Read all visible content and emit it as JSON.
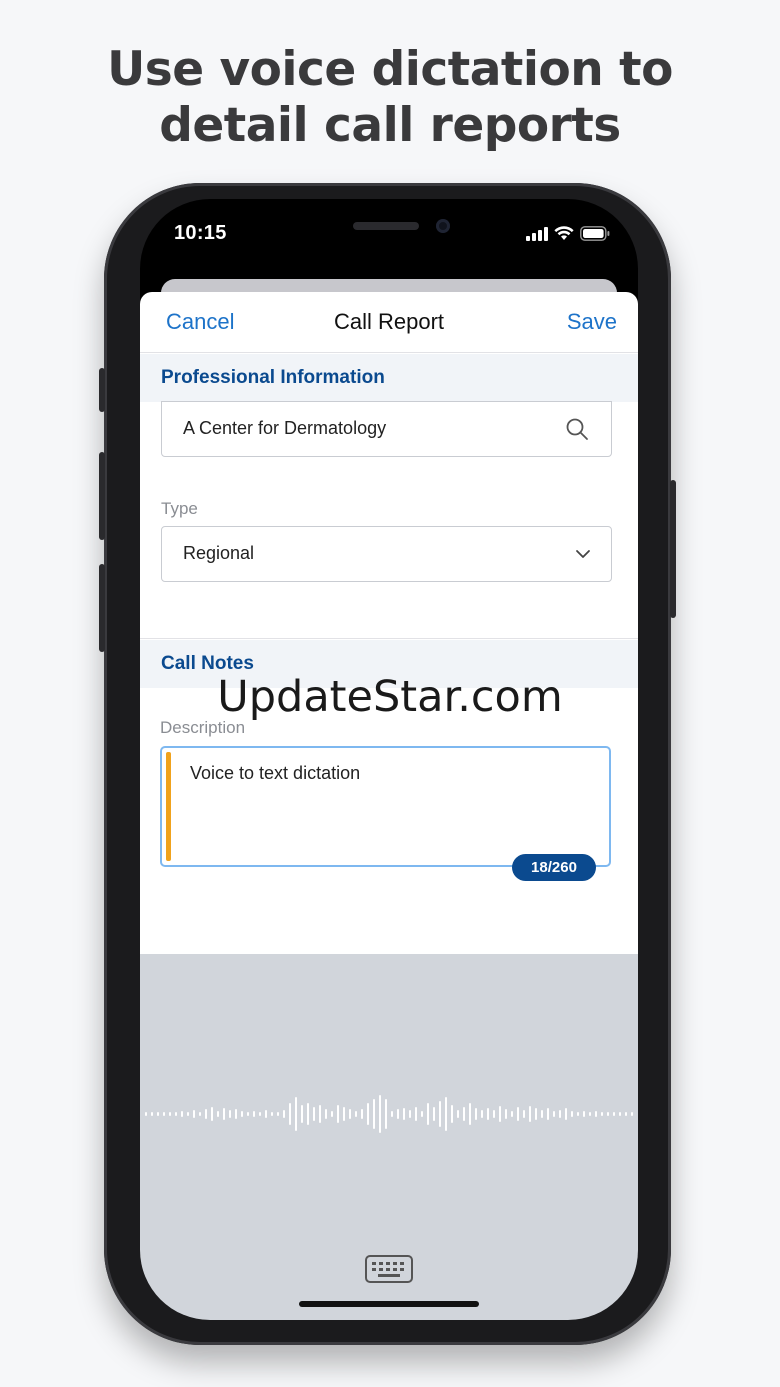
{
  "headline": {
    "line1": "Use voice dictation to",
    "line2": "detail call reports"
  },
  "status_bar": {
    "time": "10:15",
    "icons": [
      "cellular-signal-icon",
      "wifi-icon",
      "battery-icon"
    ]
  },
  "nav": {
    "cancel_label": "Cancel",
    "title": "Call Report",
    "save_label": "Save"
  },
  "professional_info": {
    "section_title": "Professional Information",
    "search_value": "A Center for Dermatology",
    "type_label": "Type",
    "type_value": "Regional"
  },
  "call_notes": {
    "section_title": "Call Notes",
    "description_label": "Description",
    "description_value": "Voice to text dictation",
    "counter": "18/260"
  },
  "watermark": "UpdateStar.com",
  "colors": {
    "accent_blue": "#1d73c9",
    "section_title": "#0b4a8f",
    "dictation_bar": "#f0a21d",
    "focus_border": "#7eb8f0"
  }
}
